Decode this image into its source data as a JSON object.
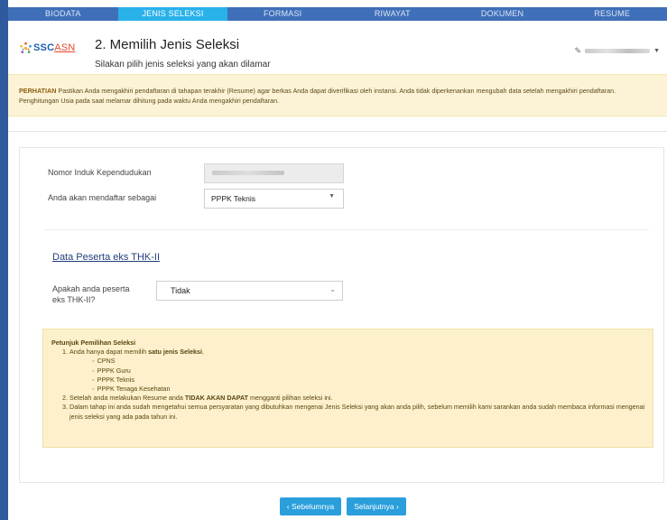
{
  "nav": {
    "tabs": [
      "BIODATA",
      "JENIS SELEKSI",
      "FORMASI",
      "RIWAYAT",
      "DOKUMEN",
      "RESUME"
    ],
    "active_index": 1
  },
  "header": {
    "logo": "SSCASN",
    "title": "2. Memilih Jenis Seleksi",
    "subtitle": "Silakan pilih jenis seleksi yang akan dilamar"
  },
  "warning": {
    "label": "PERHATIAN",
    "text": " Pastikan Anda mengakhiri pendaftaran di tahapan terakhir (Resume) agar berkas Anda dapat diverifikasi oleh instansi. Anda tidak diperkenankan mengubah data setelah mengakhiri pendaftaran. Penghitungan Usia pada saat melamar dihitung pada waktu Anda mengakhiri pendaftaran."
  },
  "form": {
    "nik_label": "Nomor Induk Kependudukan",
    "role_label": "Anda akan mendaftar sebagai",
    "role_value": "PPPK Teknis",
    "section_title": "Data Peserta eks THK-II",
    "thk_label_1": "Apakah anda peserta",
    "thk_label_2": "eks THK-II?",
    "thk_value": "Tidak"
  },
  "guide": {
    "title": "Petunjuk Pemilihan Seleksi",
    "item1_prefix": "Anda hanya dapat memilih ",
    "item1_bold": "satu jenis Seleksi",
    "item1_suffix": ".",
    "options": [
      "CPNS",
      "PPPK Guru",
      "PPPK Teknis",
      "PPPK Tenaga Kesehatan"
    ],
    "item2_prefix": "Setelah anda melakukan Resume anda ",
    "item2_bold": "TIDAK AKAN DAPAT",
    "item2_suffix": " mengganti pilihan seleksi ini.",
    "item3": "Dalam tahap ini anda sudah mengetahui semua persyaratan yang dibutuhkan mengenai Jenis Seleksi yang akan anda pilih, sebelum memilih kami sarankan anda sudah membaca informasi mengenai jenis seleksi yang ada pada tahun ini."
  },
  "buttons": {
    "prev": "‹ Sebelumnya",
    "next": "Selanjutnya ›"
  }
}
